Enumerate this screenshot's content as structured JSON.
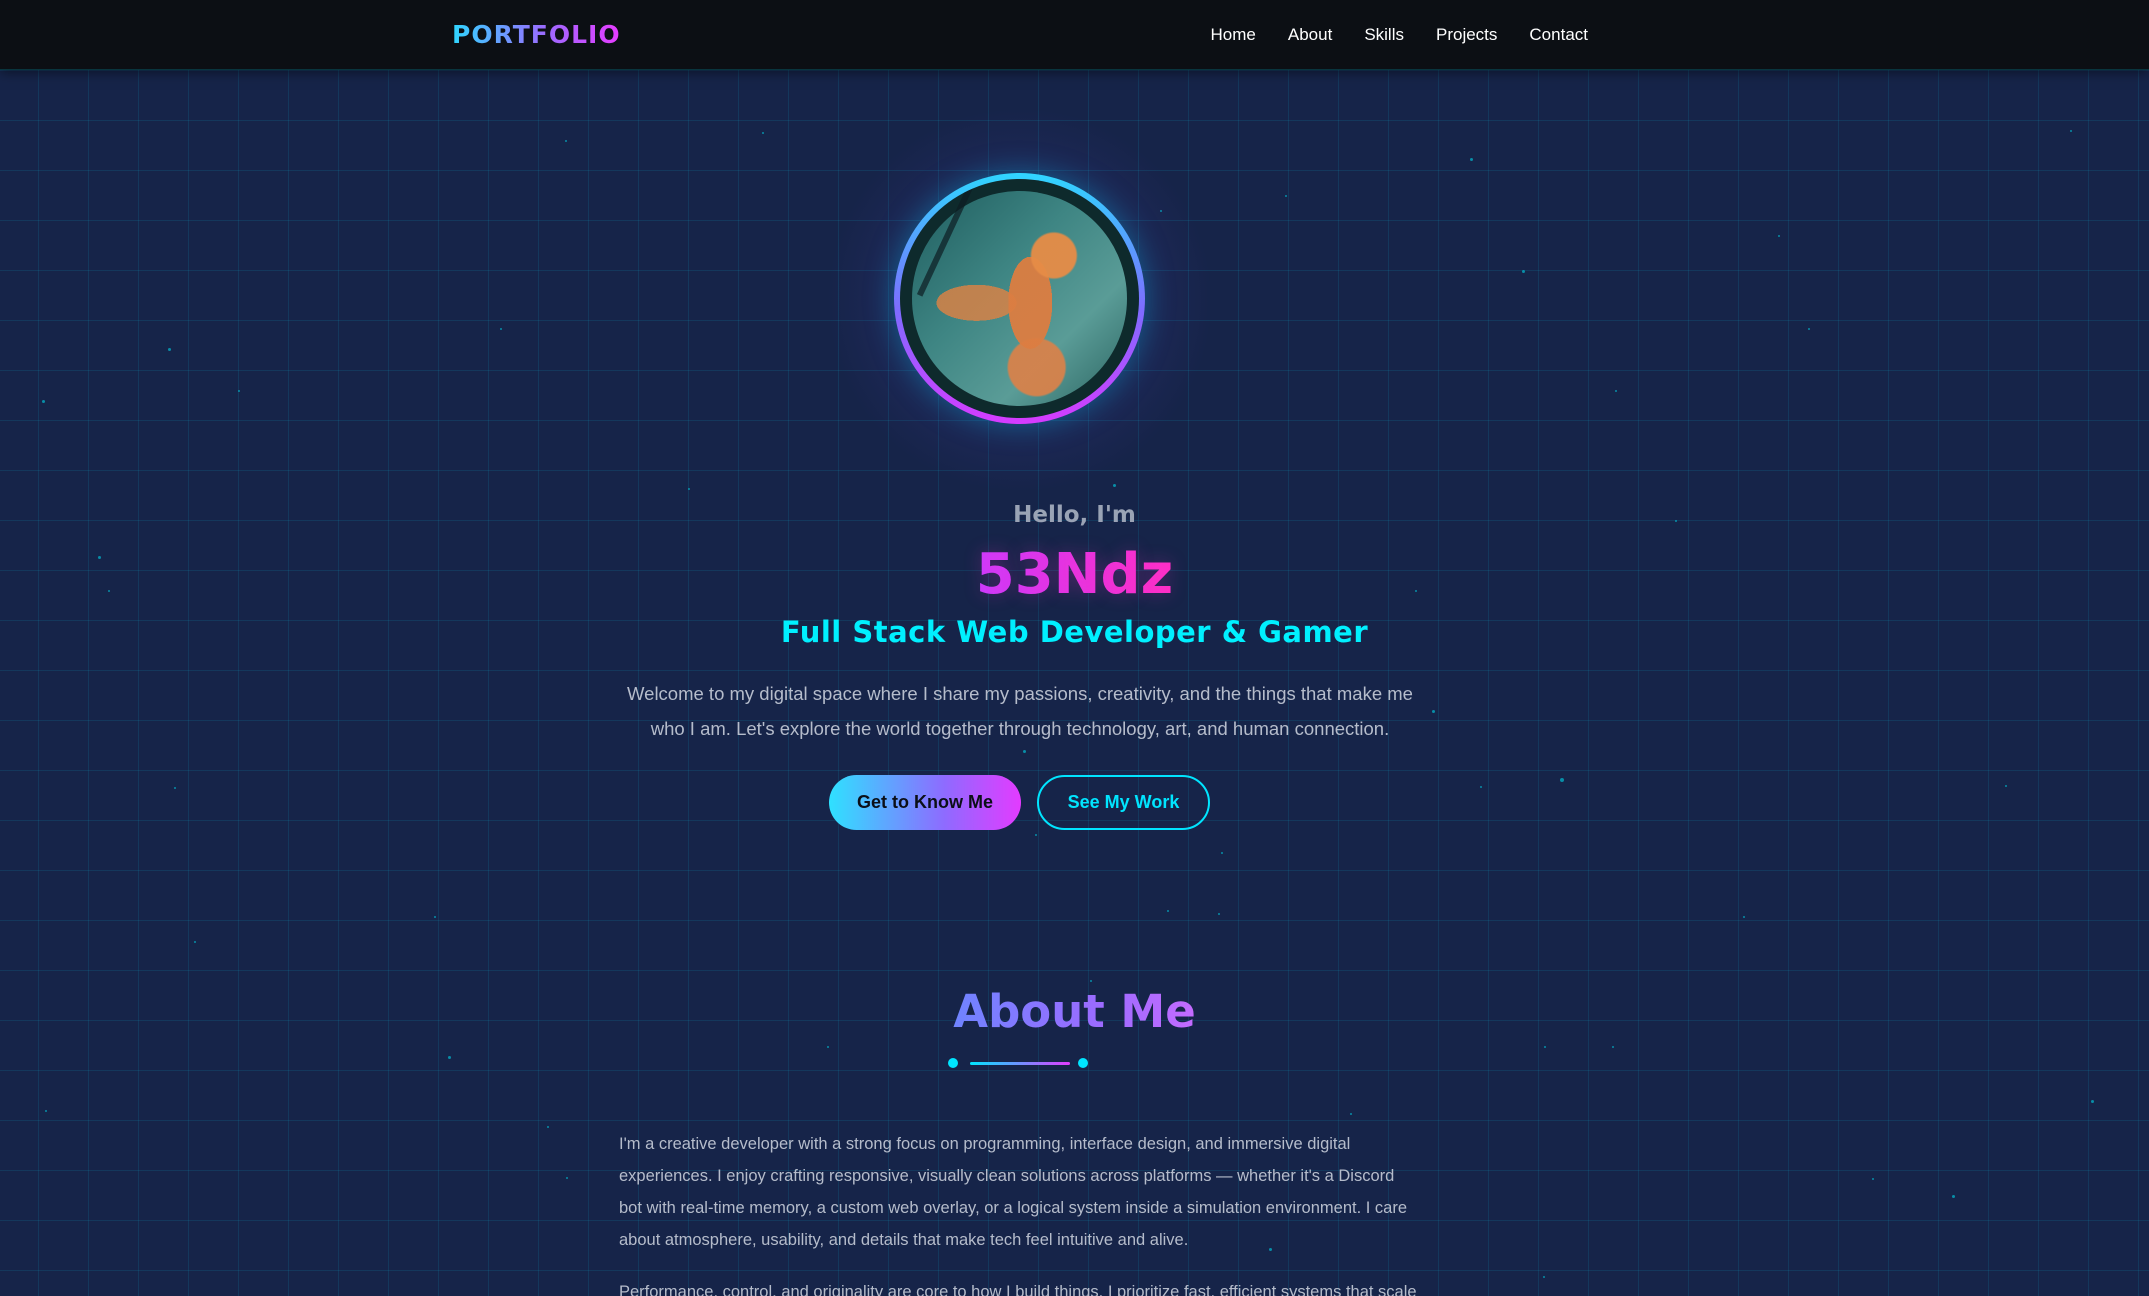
{
  "nav": {
    "logo": "PORTFOLIO",
    "links": [
      "Home",
      "About",
      "Skills",
      "Projects",
      "Contact"
    ]
  },
  "hero": {
    "greeting": "Hello, I'm",
    "name": "53Ndz",
    "role": "Full Stack Web Developer & Gamer",
    "intro": "Welcome to my digital space where I share my passions, creativity, and the things that make me who I am. Let's explore the world together through technology, art, and human connection.",
    "primary_button": "Get to Know Me",
    "secondary_button": "See My Work"
  },
  "about": {
    "title": "About Me",
    "paragraphs": [
      "I'm a creative developer with a strong focus on programming, interface design, and immersive digital experiences. I enjoy crafting responsive, visually clean solutions across platforms — whether it's a Discord bot with real-time memory, a custom web overlay, or a logical system inside a simulation environment. I care about atmosphere, usability, and details that make tech feel intuitive and alive.",
      "Performance, control, and originality are core to how I build things. I prioritize fast, efficient systems that scale"
    ]
  },
  "colors": {
    "background": "#162449",
    "navbar": "#0c0f14",
    "accent_cyan": "#00e5ff",
    "accent_magenta": "#ff2fc6",
    "accent_purple": "#9b6bff"
  }
}
